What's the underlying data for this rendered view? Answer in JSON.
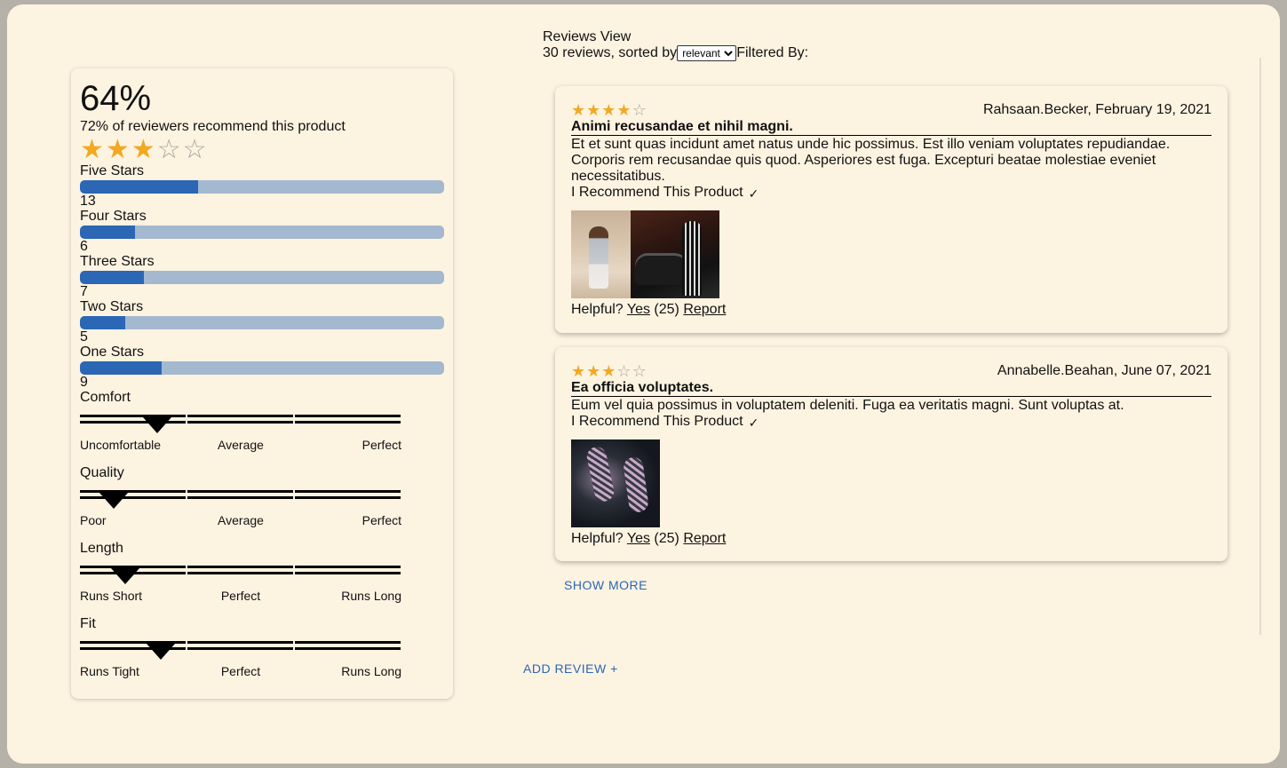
{
  "header": {
    "title": "Reviews View",
    "count_text": "30 reviews, sorted by",
    "sort_selected": "relevant",
    "filtered_by": "Filtered By:"
  },
  "ratings": {
    "average": "64%",
    "recommend_text": "72% of reviewers recommend this product",
    "star_rating": 3,
    "breakdown": [
      {
        "label": "Five Stars",
        "count": "13",
        "fraction": 0.325
      },
      {
        "label": "Four Stars",
        "count": "6",
        "fraction": 0.15
      },
      {
        "label": "Three Stars",
        "count": "7",
        "fraction": 0.175
      },
      {
        "label": "Two Stars",
        "count": "5",
        "fraction": 0.125
      },
      {
        "label": "One Stars",
        "count": "9",
        "fraction": 0.225
      }
    ]
  },
  "characteristics": [
    {
      "name": "Comfort",
      "low": "Uncomfortable",
      "mid": "Average",
      "high": "Perfect",
      "position": 0.24
    },
    {
      "name": "Quality",
      "low": "Poor",
      "mid": "Average",
      "high": "Perfect",
      "position": 0.105
    },
    {
      "name": "Length",
      "low": "Runs Short",
      "mid": "Perfect",
      "high": "Runs Long",
      "position": 0.14
    },
    {
      "name": "Fit",
      "low": "Runs Tight",
      "mid": "Perfect",
      "high": "Runs Long",
      "position": 0.25
    }
  ],
  "reviews": [
    {
      "rating": 4,
      "reviewer": "Rahsaan.Becker, February 19, 2021",
      "summary": "Animi recusandae et nihil magni.",
      "body": "Et et sunt quas incidunt amet natus unde hic possimus. Est illo veniam voluptates repudiandae. Corporis rem recusandae quis quod. Asperiores est fuga. Excepturi beatae molestiae eveniet necessitatibus.",
      "recommend": "I Recommend This Product",
      "helpful_prefix": "Helpful?",
      "yes_label": "Yes",
      "helpful_count": "(25)",
      "report_label": "Report"
    },
    {
      "rating": 3,
      "reviewer": "Annabelle.Beahan, June 07, 2021",
      "summary": "Ea officia voluptates.",
      "body": "Eum vel quia possimus in voluptatem deleniti. Fuga ea veritatis magni. Sunt voluptas at.",
      "recommend": "I Recommend This Product",
      "helpful_prefix": "Helpful?",
      "yes_label": "Yes",
      "helpful_count": "(25)",
      "report_label": "Report"
    }
  ],
  "actions": {
    "show_more": "SHOW MORE",
    "add_review": "ADD REVIEW +"
  },
  "colors": {
    "star": "#f2a922",
    "bar_fill": "#2b67b4",
    "bar_track": "#a4b8cf",
    "link": "#2b67b4",
    "background": "#fdf3e1"
  }
}
